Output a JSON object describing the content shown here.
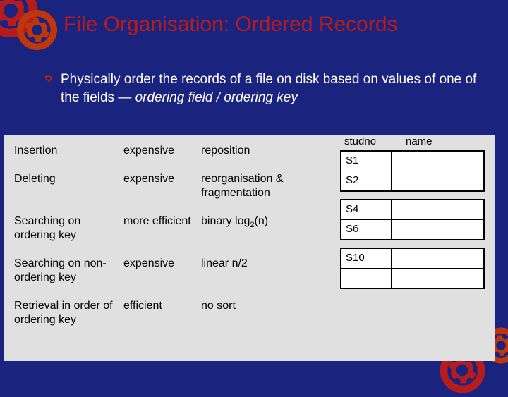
{
  "title": "File Organisation: Ordered Records",
  "bullet": {
    "text_part1": "Physically order the records of a file on disk based on values of one of the fields — ",
    "text_italic": "ordering field / ordering key"
  },
  "ops": [
    {
      "name": "Insertion",
      "cost": "expensive",
      "note": "reposition"
    },
    {
      "name": "Deleting",
      "cost": "expensive",
      "note": "reorganisation & fragmentation"
    },
    {
      "name": "Searching on ordering key",
      "cost": "more efficient",
      "note": "binary log",
      "note_sub": "2",
      "note_after": "(n)"
    },
    {
      "name": "Searching on non-ordering key",
      "cost": "expensive",
      "note": "linear n/2"
    },
    {
      "name": "Retrieval in order of ordering key",
      "cost": "efficient",
      "note": "no sort"
    }
  ],
  "blocks": {
    "header1": "studno",
    "header2": "name",
    "groups": [
      {
        "rows": [
          {
            "v": "S1"
          },
          {
            "v": "S2"
          }
        ]
      },
      {
        "rows": [
          {
            "v": "S4"
          },
          {
            "v": "S6"
          }
        ]
      },
      {
        "rows": [
          {
            "v": "S10"
          },
          {
            "v": ""
          }
        ]
      }
    ]
  }
}
